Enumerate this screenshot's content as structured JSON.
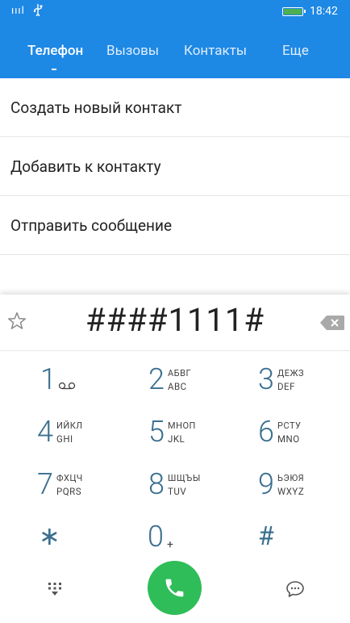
{
  "status_bar": {
    "signal": "ıııl",
    "time": "18:42"
  },
  "tabs": [
    {
      "label": "Телефон",
      "active": true
    },
    {
      "label": "Вызовы"
    },
    {
      "label": "Контакты"
    },
    {
      "label": "Еще"
    }
  ],
  "menu": [
    {
      "label": "Создать новый контакт"
    },
    {
      "label": "Добавить к контакту"
    },
    {
      "label": "Отправить сообщение"
    }
  ],
  "dialer": {
    "number": "####1111#",
    "keys": [
      {
        "digit": "1",
        "cyr": "",
        "lat": ""
      },
      {
        "digit": "2",
        "cyr": "АБВГ",
        "lat": "ABC"
      },
      {
        "digit": "3",
        "cyr": "ДЕЖЗ",
        "lat": "DEF"
      },
      {
        "digit": "4",
        "cyr": "ИЙКЛ",
        "lat": "GHI"
      },
      {
        "digit": "5",
        "cyr": "МНОП",
        "lat": "JKL"
      },
      {
        "digit": "6",
        "cyr": "РСТУ",
        "lat": "MNO"
      },
      {
        "digit": "7",
        "cyr": "ФХЦЧ",
        "lat": "PQRS"
      },
      {
        "digit": "8",
        "cyr": "ШЩЪЫ",
        "lat": "TUV"
      },
      {
        "digit": "9",
        "cyr": "ЬЭЮЯ",
        "lat": "WXYZ"
      },
      {
        "digit": "0",
        "sub": "+"
      }
    ],
    "star_key": "∗",
    "hash_key": "#"
  },
  "colors": {
    "header": "#1E88E5",
    "call_button": "#2EBD59",
    "digit": "#3a6f8f"
  }
}
